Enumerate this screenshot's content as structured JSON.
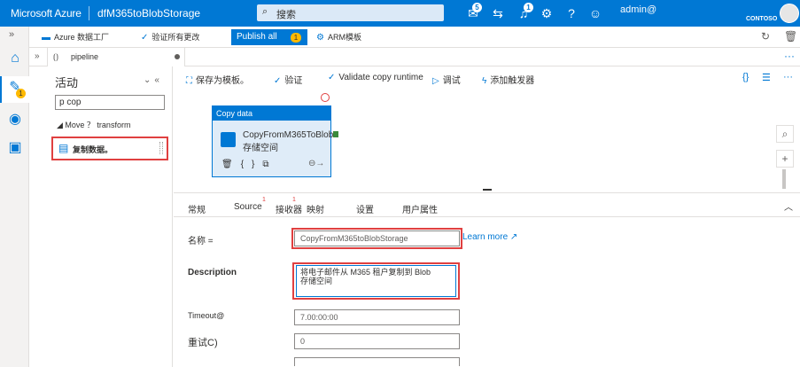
{
  "topbar": {
    "brand": "Microsoft Azure",
    "factory_name": "dfM365toBlobStorage",
    "search_placeholder": "搜索",
    "notifications_badge": "5",
    "alerts_badge": "1",
    "user_name": "admin@",
    "org": "CONTOSO"
  },
  "rail": {
    "pending_badge": "1"
  },
  "factory_toolbar": {
    "adf": "Azure 数据工厂",
    "validate_all": "验证所有更改",
    "publish_all": "Publish all",
    "publish_count": "1",
    "arm_template": "ARM模板"
  },
  "tabs": {
    "pipeline": "pipeline"
  },
  "activities": {
    "title": "活动",
    "filter_value": "p cop",
    "group": "Move ？ transform",
    "item": "复制数据。"
  },
  "pipeline_toolbar": {
    "save_template": "保存为模板。",
    "validate": "验证",
    "validate_copy_runtime": "Validate copy runtime",
    "debug": "调试",
    "add_trigger": "添加触发器"
  },
  "node": {
    "header": "Copy data",
    "name_line1": "CopyFromM365ToBlob",
    "name_line2": "存储空间"
  },
  "bottom_tabs": {
    "general": "常规",
    "source": "Source",
    "source_badge": "1",
    "sink": "接收器",
    "sink_badge": "1",
    "mapping": "映射",
    "settings": "设置",
    "user_properties": "用户属性"
  },
  "form": {
    "name_label": "名称 =",
    "name_value": "CopyFromM365toBlobStorage",
    "learn_more": "Learn more",
    "description_label": "Description",
    "description_line1": "将电子邮件从 M365 租户复制到 Blob",
    "description_line2": "存储空间",
    "timeout_label": "Timeout@",
    "timeout_value": "7.00:00:00",
    "retry_label": "重试C)",
    "retry_value": "0"
  }
}
